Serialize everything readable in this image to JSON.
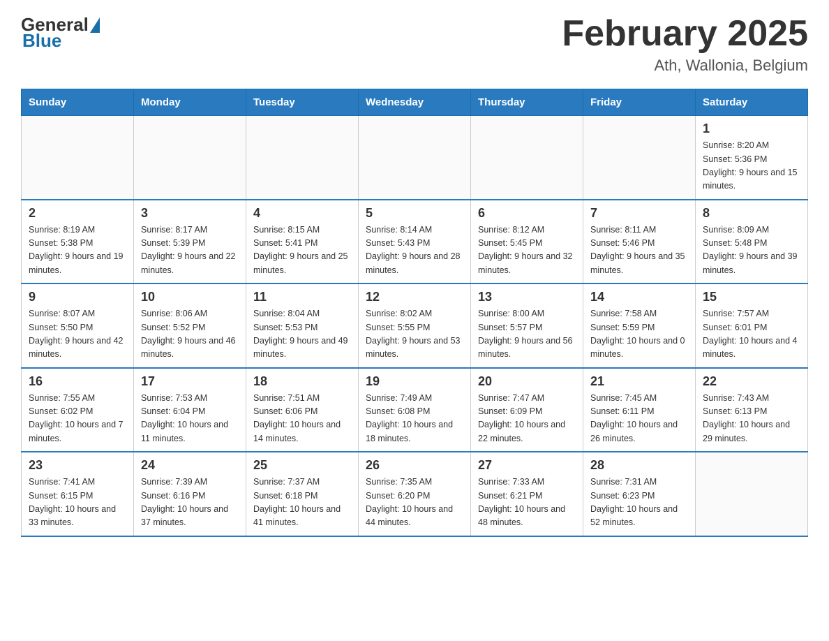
{
  "header": {
    "logo_general": "General",
    "logo_blue": "Blue",
    "title": "February 2025",
    "subtitle": "Ath, Wallonia, Belgium"
  },
  "days_of_week": [
    "Sunday",
    "Monday",
    "Tuesday",
    "Wednesday",
    "Thursday",
    "Friday",
    "Saturday"
  ],
  "weeks": [
    [
      {
        "day": "",
        "info": ""
      },
      {
        "day": "",
        "info": ""
      },
      {
        "day": "",
        "info": ""
      },
      {
        "day": "",
        "info": ""
      },
      {
        "day": "",
        "info": ""
      },
      {
        "day": "",
        "info": ""
      },
      {
        "day": "1",
        "info": "Sunrise: 8:20 AM\nSunset: 5:36 PM\nDaylight: 9 hours and 15 minutes."
      }
    ],
    [
      {
        "day": "2",
        "info": "Sunrise: 8:19 AM\nSunset: 5:38 PM\nDaylight: 9 hours and 19 minutes."
      },
      {
        "day": "3",
        "info": "Sunrise: 8:17 AM\nSunset: 5:39 PM\nDaylight: 9 hours and 22 minutes."
      },
      {
        "day": "4",
        "info": "Sunrise: 8:15 AM\nSunset: 5:41 PM\nDaylight: 9 hours and 25 minutes."
      },
      {
        "day": "5",
        "info": "Sunrise: 8:14 AM\nSunset: 5:43 PM\nDaylight: 9 hours and 28 minutes."
      },
      {
        "day": "6",
        "info": "Sunrise: 8:12 AM\nSunset: 5:45 PM\nDaylight: 9 hours and 32 minutes."
      },
      {
        "day": "7",
        "info": "Sunrise: 8:11 AM\nSunset: 5:46 PM\nDaylight: 9 hours and 35 minutes."
      },
      {
        "day": "8",
        "info": "Sunrise: 8:09 AM\nSunset: 5:48 PM\nDaylight: 9 hours and 39 minutes."
      }
    ],
    [
      {
        "day": "9",
        "info": "Sunrise: 8:07 AM\nSunset: 5:50 PM\nDaylight: 9 hours and 42 minutes."
      },
      {
        "day": "10",
        "info": "Sunrise: 8:06 AM\nSunset: 5:52 PM\nDaylight: 9 hours and 46 minutes."
      },
      {
        "day": "11",
        "info": "Sunrise: 8:04 AM\nSunset: 5:53 PM\nDaylight: 9 hours and 49 minutes."
      },
      {
        "day": "12",
        "info": "Sunrise: 8:02 AM\nSunset: 5:55 PM\nDaylight: 9 hours and 53 minutes."
      },
      {
        "day": "13",
        "info": "Sunrise: 8:00 AM\nSunset: 5:57 PM\nDaylight: 9 hours and 56 minutes."
      },
      {
        "day": "14",
        "info": "Sunrise: 7:58 AM\nSunset: 5:59 PM\nDaylight: 10 hours and 0 minutes."
      },
      {
        "day": "15",
        "info": "Sunrise: 7:57 AM\nSunset: 6:01 PM\nDaylight: 10 hours and 4 minutes."
      }
    ],
    [
      {
        "day": "16",
        "info": "Sunrise: 7:55 AM\nSunset: 6:02 PM\nDaylight: 10 hours and 7 minutes."
      },
      {
        "day": "17",
        "info": "Sunrise: 7:53 AM\nSunset: 6:04 PM\nDaylight: 10 hours and 11 minutes."
      },
      {
        "day": "18",
        "info": "Sunrise: 7:51 AM\nSunset: 6:06 PM\nDaylight: 10 hours and 14 minutes."
      },
      {
        "day": "19",
        "info": "Sunrise: 7:49 AM\nSunset: 6:08 PM\nDaylight: 10 hours and 18 minutes."
      },
      {
        "day": "20",
        "info": "Sunrise: 7:47 AM\nSunset: 6:09 PM\nDaylight: 10 hours and 22 minutes."
      },
      {
        "day": "21",
        "info": "Sunrise: 7:45 AM\nSunset: 6:11 PM\nDaylight: 10 hours and 26 minutes."
      },
      {
        "day": "22",
        "info": "Sunrise: 7:43 AM\nSunset: 6:13 PM\nDaylight: 10 hours and 29 minutes."
      }
    ],
    [
      {
        "day": "23",
        "info": "Sunrise: 7:41 AM\nSunset: 6:15 PM\nDaylight: 10 hours and 33 minutes."
      },
      {
        "day": "24",
        "info": "Sunrise: 7:39 AM\nSunset: 6:16 PM\nDaylight: 10 hours and 37 minutes."
      },
      {
        "day": "25",
        "info": "Sunrise: 7:37 AM\nSunset: 6:18 PM\nDaylight: 10 hours and 41 minutes."
      },
      {
        "day": "26",
        "info": "Sunrise: 7:35 AM\nSunset: 6:20 PM\nDaylight: 10 hours and 44 minutes."
      },
      {
        "day": "27",
        "info": "Sunrise: 7:33 AM\nSunset: 6:21 PM\nDaylight: 10 hours and 48 minutes."
      },
      {
        "day": "28",
        "info": "Sunrise: 7:31 AM\nSunset: 6:23 PM\nDaylight: 10 hours and 52 minutes."
      },
      {
        "day": "",
        "info": ""
      }
    ]
  ]
}
